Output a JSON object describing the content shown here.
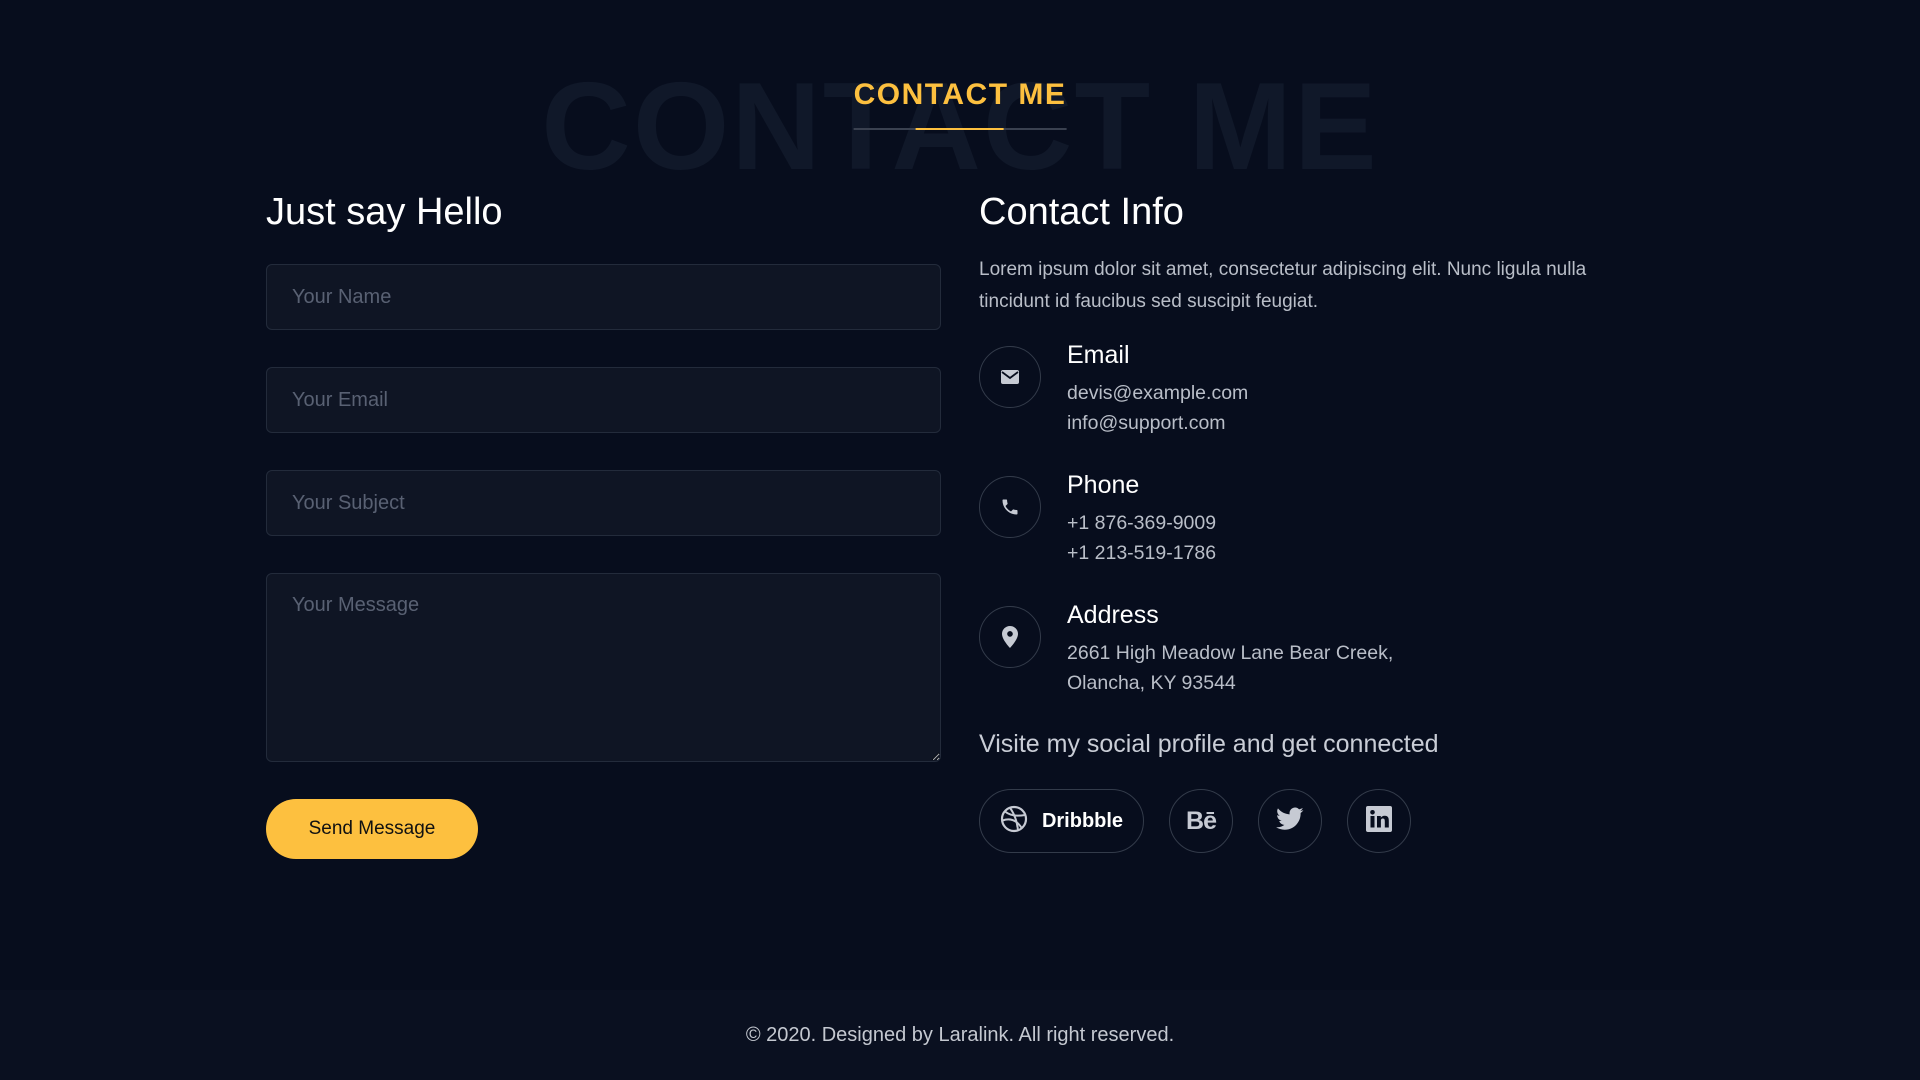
{
  "section": {
    "title": "CONTACT ME",
    "background_title": "CONTACT ME"
  },
  "form": {
    "title": "Just say Hello",
    "name_placeholder": "Your Name",
    "email_placeholder": "Your Email",
    "subject_placeholder": "Your Subject",
    "message_placeholder": "Your Message",
    "submit_label": "Send Message"
  },
  "contact_info": {
    "title": "Contact Info",
    "description": "Lorem ipsum dolor sit amet, consectetur adipiscing elit. Nunc ligula nulla tincidunt id faucibus sed suscipit feugiat.",
    "items": [
      {
        "icon": "envelope-icon",
        "title": "Email",
        "lines": [
          "devis@example.com",
          "info@support.com"
        ]
      },
      {
        "icon": "phone-icon",
        "title": "Phone",
        "lines": [
          "+1 876-369-9009",
          "+1 213-519-1786"
        ]
      },
      {
        "icon": "map-pin-icon",
        "title": "Address",
        "lines": [
          "2661 High Meadow Lane Bear Creek,",
          "Olancha, KY 93544"
        ]
      }
    ]
  },
  "social": {
    "title": "Visite my social profile and get connected",
    "dribbble_label": "Dribbble",
    "behance_label": "Bē",
    "icons": [
      "dribbble-icon",
      "behance-icon",
      "twitter-icon",
      "linkedin-icon"
    ]
  },
  "footer": {
    "text": "© 2020. Designed by Laralink. All right reserved."
  },
  "colors": {
    "background": "#070d1d",
    "accent": "#fdc03f",
    "field_background": "#0f1524",
    "footer_background": "#0a1020"
  }
}
